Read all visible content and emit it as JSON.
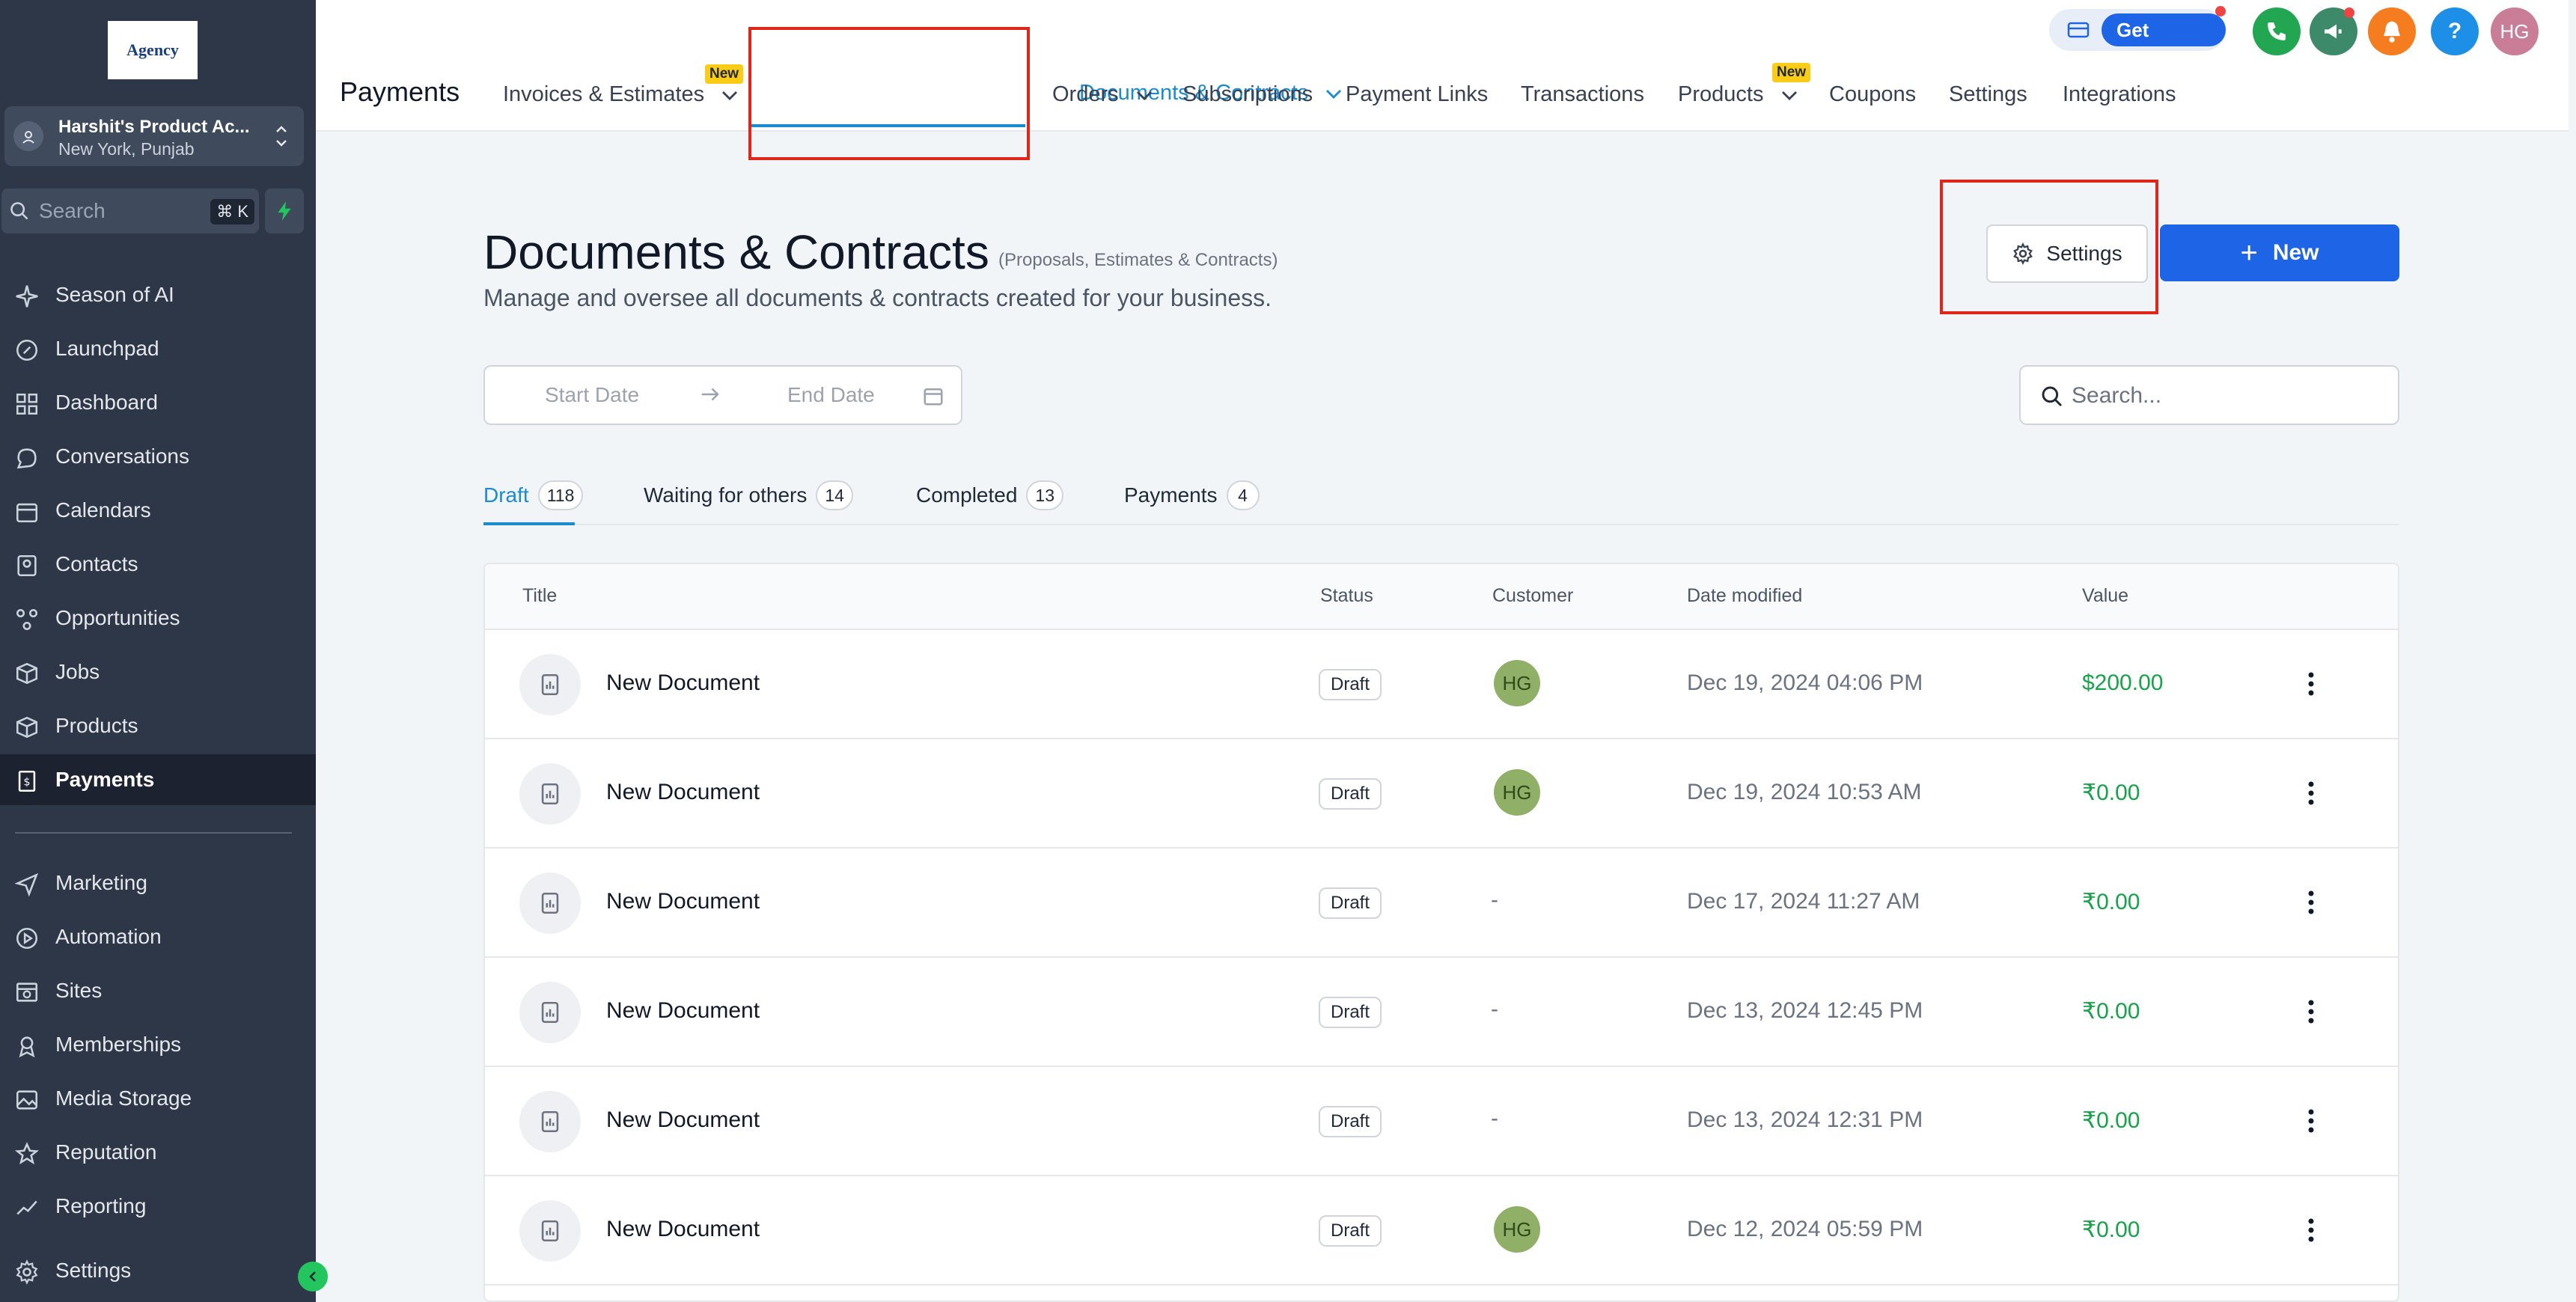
{
  "sidebar": {
    "logo_text": "Agency",
    "account": {
      "name": "Harshit's Product Ac...",
      "location": "New York, Punjab"
    },
    "search": {
      "placeholder": "Search",
      "shortcut": "⌘ K"
    },
    "items": [
      {
        "label": "Season of AI",
        "icon": "sparkle-icon"
      },
      {
        "label": "Launchpad",
        "icon": "rocket-icon"
      },
      {
        "label": "Dashboard",
        "icon": "dashboard-icon"
      },
      {
        "label": "Conversations",
        "icon": "chat-icon"
      },
      {
        "label": "Calendars",
        "icon": "calendar-icon"
      },
      {
        "label": "Contacts",
        "icon": "contacts-icon"
      },
      {
        "label": "Opportunities",
        "icon": "opportunities-icon"
      },
      {
        "label": "Jobs",
        "icon": "box-icon"
      },
      {
        "label": "Products",
        "icon": "cube-icon"
      },
      {
        "label": "Payments",
        "icon": "receipt-icon",
        "active": true
      },
      {
        "label": "Marketing",
        "icon": "send-icon"
      },
      {
        "label": "Automation",
        "icon": "automation-icon"
      },
      {
        "label": "Sites",
        "icon": "sites-icon"
      },
      {
        "label": "Memberships",
        "icon": "membership-icon"
      },
      {
        "label": "Media Storage",
        "icon": "image-icon"
      },
      {
        "label": "Reputation",
        "icon": "star-icon"
      },
      {
        "label": "Reporting",
        "icon": "trend-icon"
      },
      {
        "label": "Settings",
        "icon": "gear-icon"
      }
    ]
  },
  "topbar": {
    "section_title": "Payments",
    "tabs": [
      {
        "label": "Invoices & Estimates",
        "dropdown": true,
        "badge": "New"
      },
      {
        "label": "Documents & Contracts",
        "dropdown": true,
        "active": true
      },
      {
        "label": "Orders",
        "dropdown": true
      },
      {
        "label": "Subscriptions"
      },
      {
        "label": "Payment Links"
      },
      {
        "label": "Transactions"
      },
      {
        "label": "Products",
        "dropdown": true,
        "badge": "New"
      },
      {
        "label": "Coupons"
      },
      {
        "label": "Settings"
      },
      {
        "label": "Integrations"
      }
    ],
    "get_started": "Get Started",
    "help": "?",
    "user_initials": "HG"
  },
  "page": {
    "title": "Documents & Contracts",
    "title_note": "(Proposals, Estimates & Contracts)",
    "description": "Manage and oversee all documents & contracts created for your business.",
    "settings_button": "Settings",
    "new_button": "New",
    "date_start": "Start Date",
    "date_end": "End Date",
    "search_placeholder": "Search..."
  },
  "subtabs": [
    {
      "label": "Draft",
      "count": "118",
      "active": true
    },
    {
      "label": "Waiting for others",
      "count": "14"
    },
    {
      "label": "Completed",
      "count": "13"
    },
    {
      "label": "Payments",
      "count": "4"
    }
  ],
  "table": {
    "columns": [
      "Title",
      "Status",
      "Customer",
      "Date modified",
      "Value"
    ],
    "rows": [
      {
        "title": "New Document",
        "status": "Draft",
        "customer": "HG",
        "date": "Dec 19, 2024 04:06 PM",
        "value": "$200.00"
      },
      {
        "title": "New Document",
        "status": "Draft",
        "customer": "HG",
        "date": "Dec 19, 2024 10:53 AM",
        "value": "₹0.00"
      },
      {
        "title": "New Document",
        "status": "Draft",
        "customer": "-",
        "date": "Dec 17, 2024 11:27 AM",
        "value": "₹0.00"
      },
      {
        "title": "New Document",
        "status": "Draft",
        "customer": "-",
        "date": "Dec 13, 2024 12:45 PM",
        "value": "₹0.00"
      },
      {
        "title": "New Document",
        "status": "Draft",
        "customer": "-",
        "date": "Dec 13, 2024 12:31 PM",
        "value": "₹0.00"
      },
      {
        "title": "New Document",
        "status": "Draft",
        "customer": "HG",
        "date": "Dec 12, 2024 05:59 PM",
        "value": "₹0.00"
      }
    ]
  },
  "colors": {
    "sidebar_bg": "#2d3748",
    "accent_blue": "#1e64e6",
    "active_tab": "#1a8bd0",
    "value_green": "#16a34a",
    "highlight_red": "#e0251b"
  }
}
